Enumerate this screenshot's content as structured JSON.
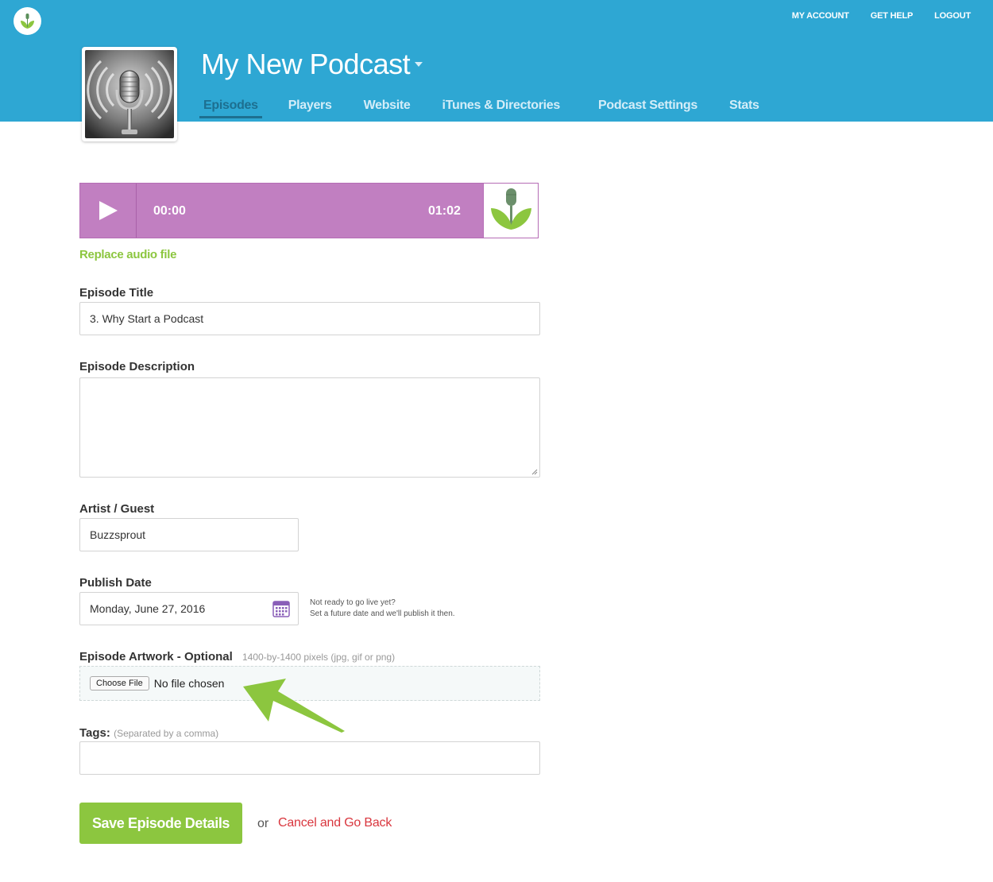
{
  "header": {
    "nav": [
      "MY ACCOUNT",
      "GET HELP",
      "LOGOUT"
    ],
    "podcast_title": "My New Podcast",
    "tabs": [
      "Episodes",
      "Players",
      "Website",
      "iTunes & Directories",
      "Podcast Settings",
      "Stats"
    ],
    "active_tab": "Episodes",
    "colors": {
      "bar": "#2ea7d3",
      "active_tab": "#1d6f90"
    }
  },
  "player": {
    "current_time": "00:00",
    "duration": "01:02",
    "color": "#c17fc1"
  },
  "replace_audio_label": "Replace audio file",
  "form": {
    "title_label": "Episode Title",
    "title_value": "3. Why Start a Podcast",
    "description_label": "Episode Description",
    "description_value": "",
    "artist_label": "Artist / Guest",
    "artist_value": "Buzzsprout",
    "publish_label": "Publish Date",
    "publish_value": "Monday, June 27, 2016",
    "publish_hint_1": "Not ready to go live yet?",
    "publish_hint_2": "Set a future date and we'll publish it then.",
    "artwork_label": "Episode Artwork - Optional",
    "artwork_hint": "1400-by-1400 pixels (jpg, gif or png)",
    "choose_file_label": "Choose File",
    "no_file_label": "No file chosen",
    "tags_label": "Tags:",
    "tags_hint": "(Separated by a comma)",
    "tags_value": ""
  },
  "actions": {
    "save_label": "Save Episode Details",
    "or_label": "or",
    "cancel_label": "Cancel and Go Back"
  },
  "accent_color": "#8cc63f",
  "cancel_color": "#d9363e"
}
